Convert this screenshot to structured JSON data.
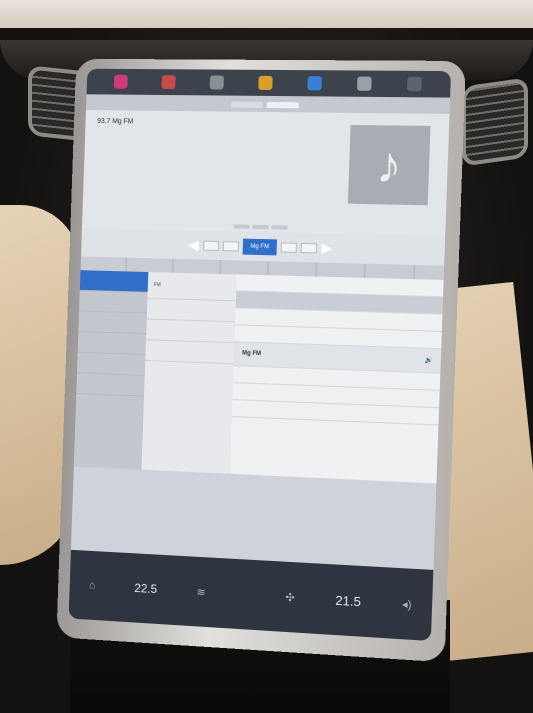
{
  "screen": {
    "tabs": [
      {
        "label": "",
        "active": false
      },
      {
        "label": "",
        "active": true
      }
    ],
    "now_playing": {
      "station_title": "93.7 Mg FM",
      "album_art_icon": "music-note-icon"
    },
    "mini_toggle": [
      "",
      "",
      ""
    ],
    "presets": [
      {
        "label": "",
        "active": false
      },
      {
        "label": "",
        "active": false
      },
      {
        "label": "Mg FM",
        "active": true
      },
      {
        "label": "",
        "active": false
      },
      {
        "label": "",
        "active": false
      }
    ],
    "browse": {
      "categories": [
        {
          "label": "",
          "active": true
        },
        {
          "label": "",
          "active": false
        },
        {
          "label": "",
          "active": false
        },
        {
          "label": "",
          "active": false
        },
        {
          "label": "",
          "active": false
        },
        {
          "label": "",
          "active": false
        }
      ],
      "sub_items": [
        "FM",
        "",
        "",
        ""
      ],
      "list": [
        {
          "label": "",
          "highlight": false,
          "header": false
        },
        {
          "label": "",
          "highlight": false,
          "header": true
        },
        {
          "label": "",
          "highlight": false,
          "header": false
        },
        {
          "label": "",
          "highlight": false,
          "header": false
        },
        {
          "label": "Mg FM",
          "highlight": true,
          "header": false
        },
        {
          "label": "",
          "highlight": false,
          "header": false
        },
        {
          "label": "",
          "highlight": false,
          "header": false
        },
        {
          "label": "",
          "highlight": false,
          "header": false
        }
      ]
    },
    "bottom_bar": {
      "left_temp": "22.5",
      "center_label": "",
      "right_temp": "21.5",
      "volume_icon": "speaker-icon"
    }
  },
  "colors": {
    "accent": "#2f6ec9",
    "bezel": "#d8d6d3",
    "leather": "#d9c3a2"
  }
}
